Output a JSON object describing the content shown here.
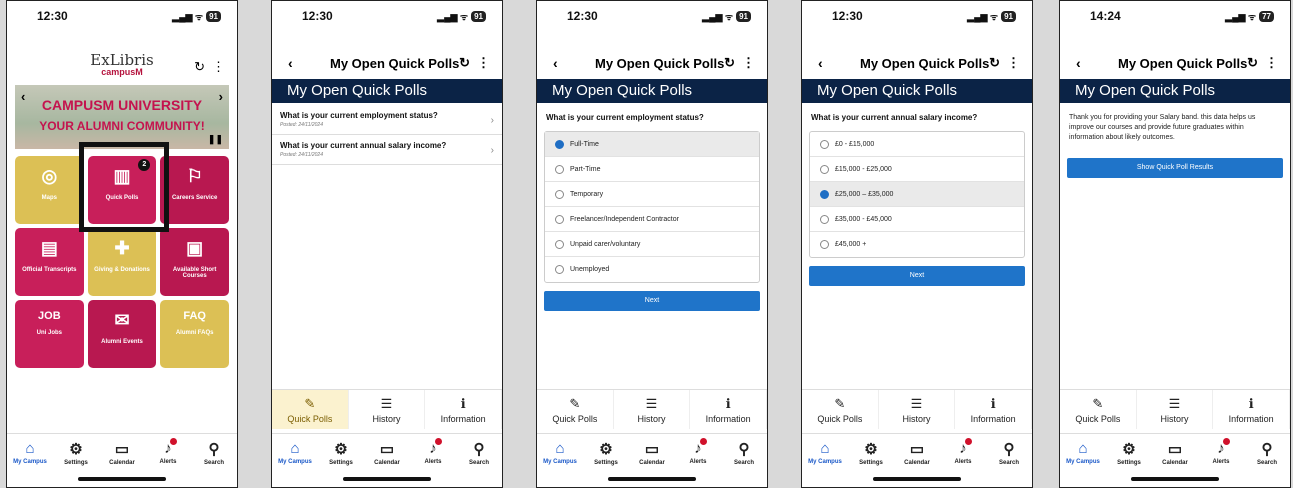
{
  "phone1": {
    "status_time": "12:30",
    "battery": "91",
    "logo_line1": "ExLibris",
    "logo_line2": "campusM",
    "hero_line1": "CAMPUSM UNIVERSITY",
    "hero_line2": "YOUR ALUMNI COMMUNITY!",
    "tiles": [
      {
        "label": "Maps",
        "icon": "location-pin-icon",
        "glyph": "◎",
        "badge": ""
      },
      {
        "label": "Quick Polls",
        "icon": "poll-chart-icon",
        "glyph": "▥",
        "badge": "2"
      },
      {
        "label": "Careers Service",
        "icon": "signpost-icon",
        "glyph": "⚐",
        "badge": ""
      },
      {
        "label": "Official Transcripts",
        "icon": "certificate-icon",
        "glyph": "▤",
        "badge": ""
      },
      {
        "label": "Giving & Donations",
        "icon": "gift-icon",
        "glyph": "🎁",
        "badge": ""
      },
      {
        "label": "Available Short Courses",
        "icon": "board-icon",
        "glyph": "▣",
        "badge": ""
      },
      {
        "label": "Uni Jobs",
        "icon": "job-icon",
        "glyph": "JOB",
        "badge": ""
      },
      {
        "label": "Alumni Events",
        "icon": "tickets-icon",
        "glyph": "✉",
        "badge": ""
      },
      {
        "label": "Alumni FAQs",
        "icon": "faq-icon",
        "glyph": "FAQ",
        "badge": ""
      }
    ]
  },
  "header_title": "My Open Quick Polls",
  "banner_title": "My Open Quick Polls",
  "bottom_nav": [
    "My Campus",
    "Settings",
    "Calendar",
    "Alerts",
    "Search"
  ],
  "tabs": [
    "Quick Polls",
    "History",
    "Information"
  ],
  "phone2": {
    "status_time": "12:30",
    "battery": "91",
    "polls": [
      {
        "question": "What is your current employment status?",
        "posted": "Posted: 24/11/2024"
      },
      {
        "question": "What is your current annual salary income?",
        "posted": "Posted: 24/11/2024"
      }
    ]
  },
  "phone3": {
    "status_time": "12:30",
    "battery": "91",
    "question": "What is your current employment status?",
    "options": [
      "Full-Time",
      "Part-Time",
      "Temporary",
      "Freelancer/Independent Contractor",
      "Unpaid carer/voluntary",
      "Unemployed"
    ],
    "selected_index": 0,
    "next_label": "Next"
  },
  "phone4": {
    "status_time": "12:30",
    "battery": "91",
    "question": "What is your current annual salary income?",
    "options": [
      "£0 - £15,000",
      "£15,000 - £25,000",
      "£25,000 – £35,000",
      "£35,000 - £45,000",
      "£45,000 +"
    ],
    "selected_index": 2,
    "next_label": "Next"
  },
  "phone5": {
    "status_time": "14:24",
    "battery": "77",
    "thanks_text": "Thank you for providing your Salary band. this data helps us improve our courses and provide future graduates within information about likely outcomes.",
    "show_results_label": "Show Quick Poll Results"
  },
  "colors": {
    "banner": "#0b2346",
    "button": "#1f74c9",
    "tile_pink": "#c81f5a",
    "tile_gold": "#dcc055"
  }
}
